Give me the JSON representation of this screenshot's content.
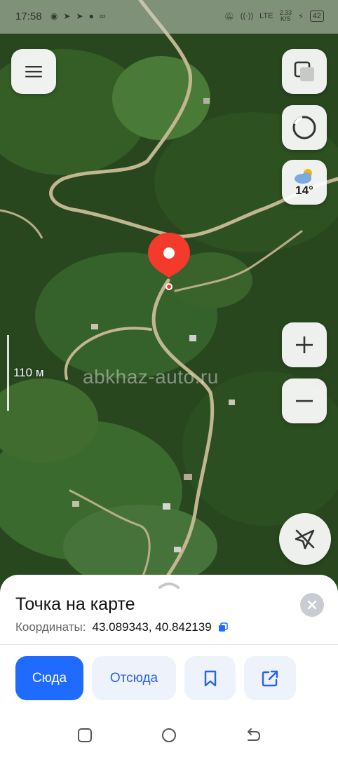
{
  "status_bar": {
    "time": "17:58",
    "left_icons": [
      "whatsapp-icon",
      "telegram-icon",
      "telegram-icon",
      "notification-icon",
      "infinity-icon"
    ],
    "network_speed": "2.33",
    "network_unit": "K/S",
    "signal": "LTE",
    "battery": "42"
  },
  "map": {
    "scale_label": "110 м",
    "watermark": "abkhaz-auto.ru",
    "weather_temp": "14°",
    "pin_color": "#f43a2a"
  },
  "sheet": {
    "title": "Точка на карте",
    "coords_label": "Координаты:",
    "coords_value": "43.089343, 40.842139"
  },
  "actions": {
    "here_label": "Сюда",
    "from_label": "Отсюда"
  },
  "colors": {
    "accent": "#1f6bff",
    "accent_text": "#2563eb",
    "light_button": "#eef2fb"
  }
}
